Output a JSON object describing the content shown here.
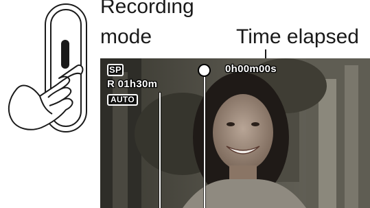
{
  "labels": {
    "recording_line1": "Recording",
    "recording_line2": "mode",
    "time_elapsed": "Time elapsed"
  },
  "osd": {
    "recording_mode": "SP",
    "remaining": "R  01h30m",
    "auto": "AUTO",
    "elapsed": "0h00m00s",
    "record_indicator": "record-dot-icon"
  },
  "colors": {
    "ink": "#1a1a1a",
    "osd_text": "#ffffff"
  },
  "icons": [
    "hand-pressing-button-icon",
    "record-dot-icon"
  ]
}
